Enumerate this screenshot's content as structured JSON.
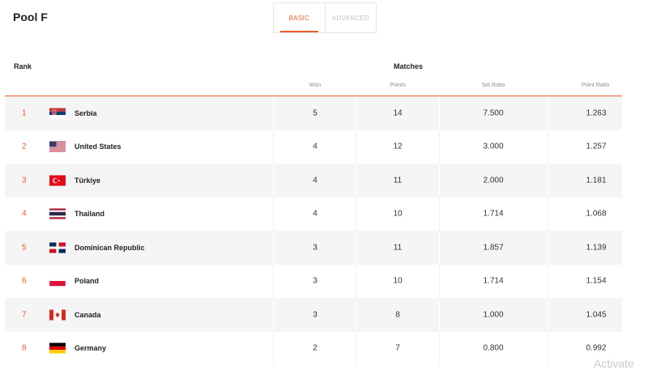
{
  "pool": {
    "title": "Pool F"
  },
  "tabs": [
    {
      "label": "BASIC",
      "active": true
    },
    {
      "label": "ADVANCED",
      "active": false
    }
  ],
  "table": {
    "rank_header": "Rank",
    "matches_header": "Matches",
    "columns": [
      "Won",
      "Points",
      "Set Ratio",
      "Point Ratio"
    ],
    "rows": [
      {
        "rank": "1",
        "team": "Serbia",
        "flag_icon": "serbia-flag-icon",
        "won": "5",
        "points": "14",
        "set_ratio": "7.500",
        "point_ratio": "1.263"
      },
      {
        "rank": "2",
        "team": "United States",
        "flag_icon": "usa-flag-icon",
        "won": "4",
        "points": "12",
        "set_ratio": "3.000",
        "point_ratio": "1.257"
      },
      {
        "rank": "3",
        "team": "Türkiye",
        "flag_icon": "turkiye-flag-icon",
        "won": "4",
        "points": "11",
        "set_ratio": "2.000",
        "point_ratio": "1.181"
      },
      {
        "rank": "4",
        "team": "Thailand",
        "flag_icon": "thailand-flag-icon",
        "won": "4",
        "points": "10",
        "set_ratio": "1.714",
        "point_ratio": "1.068"
      },
      {
        "rank": "5",
        "team": "Dominican Republic",
        "flag_icon": "dominican-republic-flag-icon",
        "won": "3",
        "points": "11",
        "set_ratio": "1.857",
        "point_ratio": "1.139"
      },
      {
        "rank": "6",
        "team": "Poland",
        "flag_icon": "poland-flag-icon",
        "won": "3",
        "points": "10",
        "set_ratio": "1.714",
        "point_ratio": "1.154"
      },
      {
        "rank": "7",
        "team": "Canada",
        "flag_icon": "canada-flag-icon",
        "won": "3",
        "points": "8",
        "set_ratio": "1.000",
        "point_ratio": "1.045"
      },
      {
        "rank": "8",
        "team": "Germany",
        "flag_icon": "germany-flag-icon",
        "won": "2",
        "points": "7",
        "set_ratio": "0.800",
        "point_ratio": "0.992"
      }
    ]
  },
  "colors": {
    "accent": "#ea5c2a",
    "row_alt": "#f5f5f5"
  },
  "watermark": "Activate"
}
